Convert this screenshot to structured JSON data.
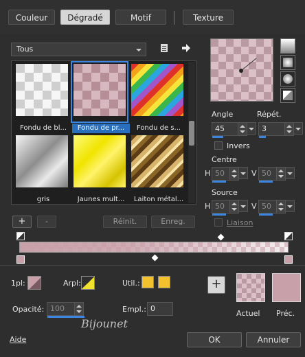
{
  "tabs": [
    {
      "label": "Couleur"
    },
    {
      "label": "Dégradé"
    },
    {
      "label": "Motif"
    },
    {
      "label": "Texture"
    }
  ],
  "category_select": {
    "value": "Tous"
  },
  "gallery": [
    {
      "caption": "Fondu de bl..."
    },
    {
      "caption": "Fondu de pr..."
    },
    {
      "caption": "Fondu de s..."
    },
    {
      "caption": "gris"
    },
    {
      "caption": "Jaunes mult..."
    },
    {
      "caption": "Laiton métal..."
    }
  ],
  "gallery_buttons": {
    "add": "+",
    "remove": "-",
    "reset": "Réinit.",
    "save": "Enreg."
  },
  "angle": {
    "label": "Angle",
    "value": "45"
  },
  "repeat": {
    "label": "Répét.",
    "value": "3"
  },
  "invert": {
    "label": "Invers"
  },
  "centre": {
    "label": "Centre",
    "h_label": "H",
    "h_value": "50",
    "v_label": "V",
    "v_value": "50"
  },
  "source": {
    "label": "Source",
    "h_label": "H",
    "h_value": "50",
    "v_label": "V",
    "v_value": "50"
  },
  "link": {
    "label": "Liaison"
  },
  "bottom": {
    "first_plan_label": "1pl:",
    "background_label": "Arpl:",
    "use_label": "Util.:",
    "opacity_label": "Opacité:",
    "opacity_value": "100",
    "location_label": "Empl.:",
    "location_value": "0",
    "current_label": "Actuel",
    "previous_label": "Préc.",
    "add_button": "+",
    "watermark": "Bijounet"
  },
  "footer": {
    "help": "Aide",
    "ok": "OK",
    "cancel": "Annuler"
  },
  "colors": {
    "accent": "#3b86e0",
    "pink": "#c8a0aa",
    "yellow": "#f2c12e"
  }
}
